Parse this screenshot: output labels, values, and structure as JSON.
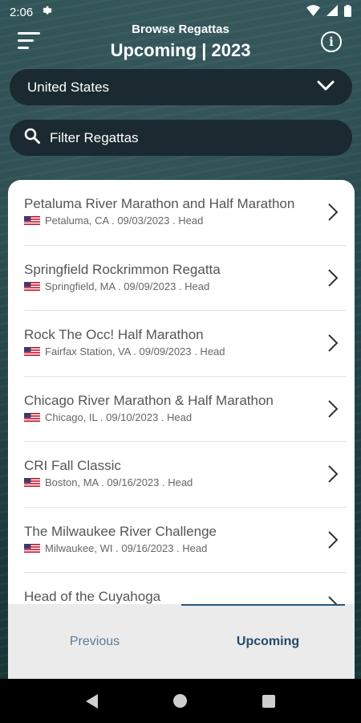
{
  "status_bar": {
    "time": "2:06",
    "icons": [
      "gear-icon",
      "wifi-icon",
      "signal-icon",
      "battery-icon"
    ]
  },
  "header": {
    "title": "Browse Regattas",
    "subtitle": "Upcoming | 2023"
  },
  "country_select": {
    "value": "United States"
  },
  "filter": {
    "placeholder": "Filter Regattas"
  },
  "regattas": [
    {
      "name": "Petaluma River Marathon and Half Marathon",
      "meta": "Petaluma, CA . 09/03/2023 . Head"
    },
    {
      "name": "Springfield Rockrimmon Regatta",
      "meta": "Springfield, MA . 09/09/2023 . Head"
    },
    {
      "name": "Rock The Occ! Half Marathon",
      "meta": "Fairfax Station, VA . 09/09/2023 . Head"
    },
    {
      "name": "Chicago River Marathon & Half Marathon",
      "meta": "Chicago, IL . 09/10/2023 . Head"
    },
    {
      "name": "CRI Fall Classic",
      "meta": "Boston, MA . 09/16/2023 . Head"
    },
    {
      "name": "The Milwaukee River Challenge",
      "meta": "Milwaukee, WI . 09/16/2023 . Head"
    },
    {
      "name": "Head of the Cuyahoga",
      "meta": ""
    }
  ],
  "tabs": {
    "previous": "Previous",
    "upcoming": "Upcoming",
    "active": "upcoming"
  },
  "colors": {
    "accent": "#25577d",
    "pill_bg": "#1a2a30"
  }
}
